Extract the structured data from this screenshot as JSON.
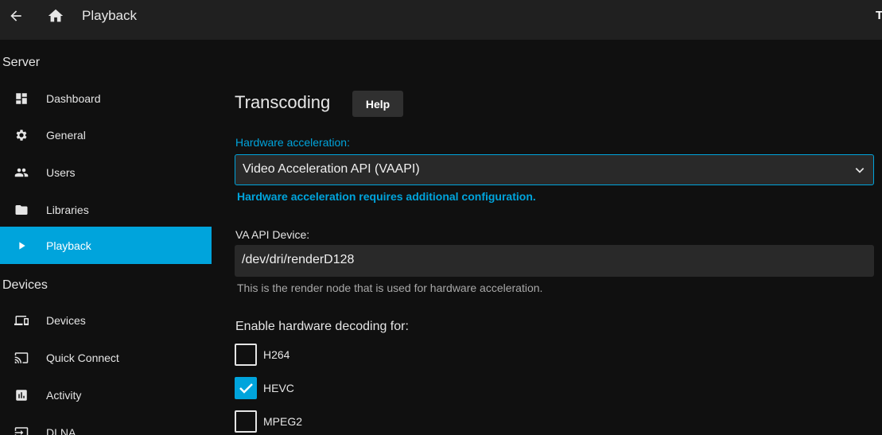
{
  "header": {
    "back_icon": "arrow-left-icon",
    "home_icon": "home-icon",
    "title": "Playback",
    "user_initial": "T"
  },
  "sidebar": {
    "sections": [
      {
        "title": "Server"
      },
      {
        "title": "Devices"
      }
    ],
    "items": [
      {
        "label": "Dashboard",
        "icon": "dashboard-icon",
        "active": false
      },
      {
        "label": "General",
        "icon": "gear-icon",
        "active": false
      },
      {
        "label": "Users",
        "icon": "users-icon",
        "active": false
      },
      {
        "label": "Libraries",
        "icon": "folder-icon",
        "active": false
      },
      {
        "label": "Playback",
        "icon": "play-icon",
        "active": true
      },
      {
        "label": "Devices",
        "icon": "devices-icon",
        "active": false
      },
      {
        "label": "Quick Connect",
        "icon": "cast-icon",
        "active": false
      },
      {
        "label": "Activity",
        "icon": "chart-icon",
        "active": false
      },
      {
        "label": "DLNA",
        "icon": "input-icon",
        "active": false
      }
    ]
  },
  "main": {
    "title": "Transcoding",
    "help_label": "Help",
    "hw_accel": {
      "label": "Hardware acceleration:",
      "value": "Video Acceleration API (VAAPI)",
      "note": "Hardware acceleration requires additional configuration."
    },
    "va_device": {
      "label": "VA API Device:",
      "value": "/dev/dri/renderD128",
      "hint": "This is the render node that is used for hardware acceleration."
    },
    "decoding": {
      "title": "Enable hardware decoding for:",
      "codecs": [
        {
          "label": "H264",
          "checked": false
        },
        {
          "label": "HEVC",
          "checked": true
        },
        {
          "label": "MPEG2",
          "checked": false
        }
      ]
    }
  },
  "colors": {
    "accent": "#00a4dc",
    "header_bg": "#202020",
    "page_bg": "#101010",
    "input_bg": "#292929"
  }
}
